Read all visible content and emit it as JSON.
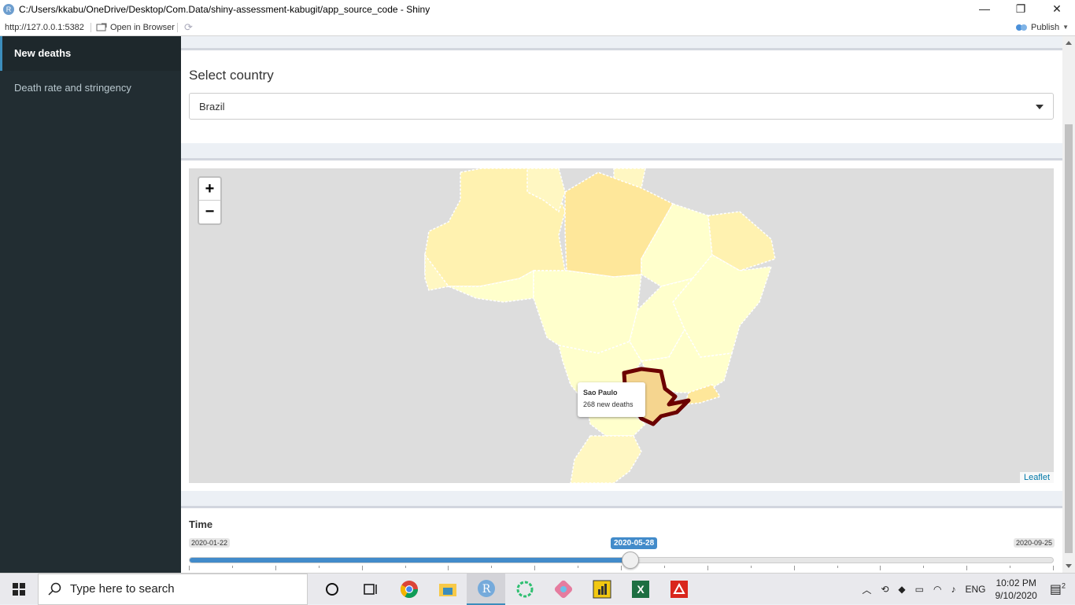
{
  "window": {
    "title": "C:/Users/kkabu/OneDrive/Desktop/Com.Data/shiny-assessment-kabugit/app_source_code - Shiny",
    "app_icon_letter": "R",
    "minimize": "—",
    "restore": "❐",
    "close": "✕"
  },
  "addressbar": {
    "url": "http://127.0.0.1:5382",
    "open_in_browser": "Open in Browser",
    "publish": "Publish"
  },
  "sidebar": {
    "items": [
      {
        "label": "New deaths",
        "active": true
      },
      {
        "label": "Death rate and stringency",
        "active": false
      }
    ]
  },
  "country_box": {
    "label": "Select country",
    "selected": "Brazil"
  },
  "map": {
    "zoom_in": "+",
    "zoom_out": "−",
    "attribution": "Leaflet",
    "tooltip": {
      "region": "Sao Paulo",
      "value": "268 new deaths"
    },
    "colors": {
      "light": "#fff7c2",
      "lighter": "#ffffcc",
      "medium": "#fee79a",
      "highlight": "#f5d58f",
      "border": "#6b0000"
    }
  },
  "time_box": {
    "label": "Time",
    "min": "2020-01-22",
    "max": "2020-09-25",
    "value": "2020-05-28",
    "progress": 0.51
  },
  "taskbar": {
    "search_placeholder": "Type here to search",
    "language": "ENG",
    "time": "10:02 PM",
    "date": "9/10/2020",
    "notifications": "2",
    "icons": [
      "cortana-icon",
      "task-view-icon",
      "chrome-icon",
      "file-explorer-icon",
      "rstudio-icon",
      "refresh-app-icon",
      "paint-icon",
      "powerbi-icon",
      "excel-icon",
      "acrobat-icon"
    ]
  }
}
